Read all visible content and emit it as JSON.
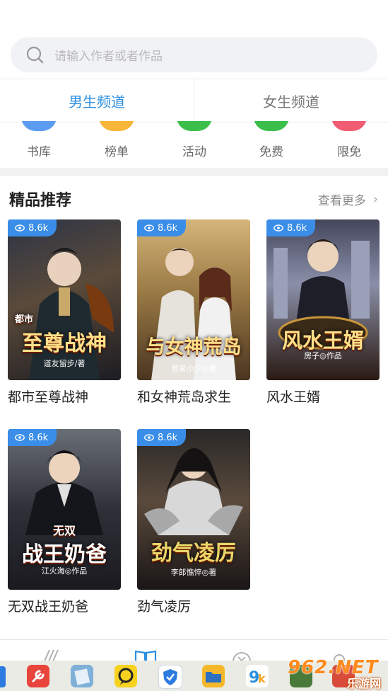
{
  "search": {
    "placeholder": "请输入作者或者作品"
  },
  "tabs": [
    {
      "label": "男生频道",
      "active": true
    },
    {
      "label": "女生频道",
      "active": false
    }
  ],
  "categories": [
    {
      "label": "书库",
      "color": "#5b9cf0"
    },
    {
      "label": "榜单",
      "color": "#f5b63a"
    },
    {
      "label": "活动",
      "color": "#3cbf4a"
    },
    {
      "label": "免费",
      "color": "#3cbf4a"
    },
    {
      "label": "限免",
      "color": "#f05d72"
    }
  ],
  "section": {
    "title": "精品推荐",
    "more": "查看更多"
  },
  "books": [
    {
      "title": "都市至尊战神",
      "views": "8.6k",
      "cover_title": "至尊战神",
      "cover_sub": "都市",
      "cover_author": "道友留步/著",
      "palette": [
        "#283040",
        "#6a4a2a",
        "#1c1c22"
      ]
    },
    {
      "title": "和女神荒岛求生",
      "views": "8.6k",
      "cover_title": "与女神荒岛",
      "cover_sub": "",
      "cover_author": "曾家小少◎著",
      "palette": [
        "#c9a96a",
        "#7a5a30",
        "#3e2b18"
      ]
    },
    {
      "title": "风水王婿",
      "views": "8.6k",
      "cover_title": "风水王婿",
      "cover_sub": "",
      "cover_author": "房子◎作品",
      "palette": [
        "#3a3c52",
        "#8a8fa8",
        "#2a1a12"
      ]
    },
    {
      "title": "无双战王奶爸",
      "views": "8.6k",
      "cover_title": "战王奶爸",
      "cover_sub": "无双",
      "cover_author": "江火海◎作品",
      "palette": [
        "#5a5e66",
        "#2a2c33",
        "#1a1a1f"
      ]
    },
    {
      "title": "劲气凌厉",
      "views": "8.6k",
      "cover_title": "劲气凌厉",
      "cover_sub": "",
      "cover_author": "李郎憔悴◎著",
      "palette": [
        "#2c2a2a",
        "#6a5a4a",
        "#1a1616"
      ]
    }
  ],
  "watermark": {
    "main": "962.NET",
    "sub": "乐游网"
  },
  "colors": {
    "accent": "#2b8fe0",
    "badge": "#3a8ee8"
  }
}
